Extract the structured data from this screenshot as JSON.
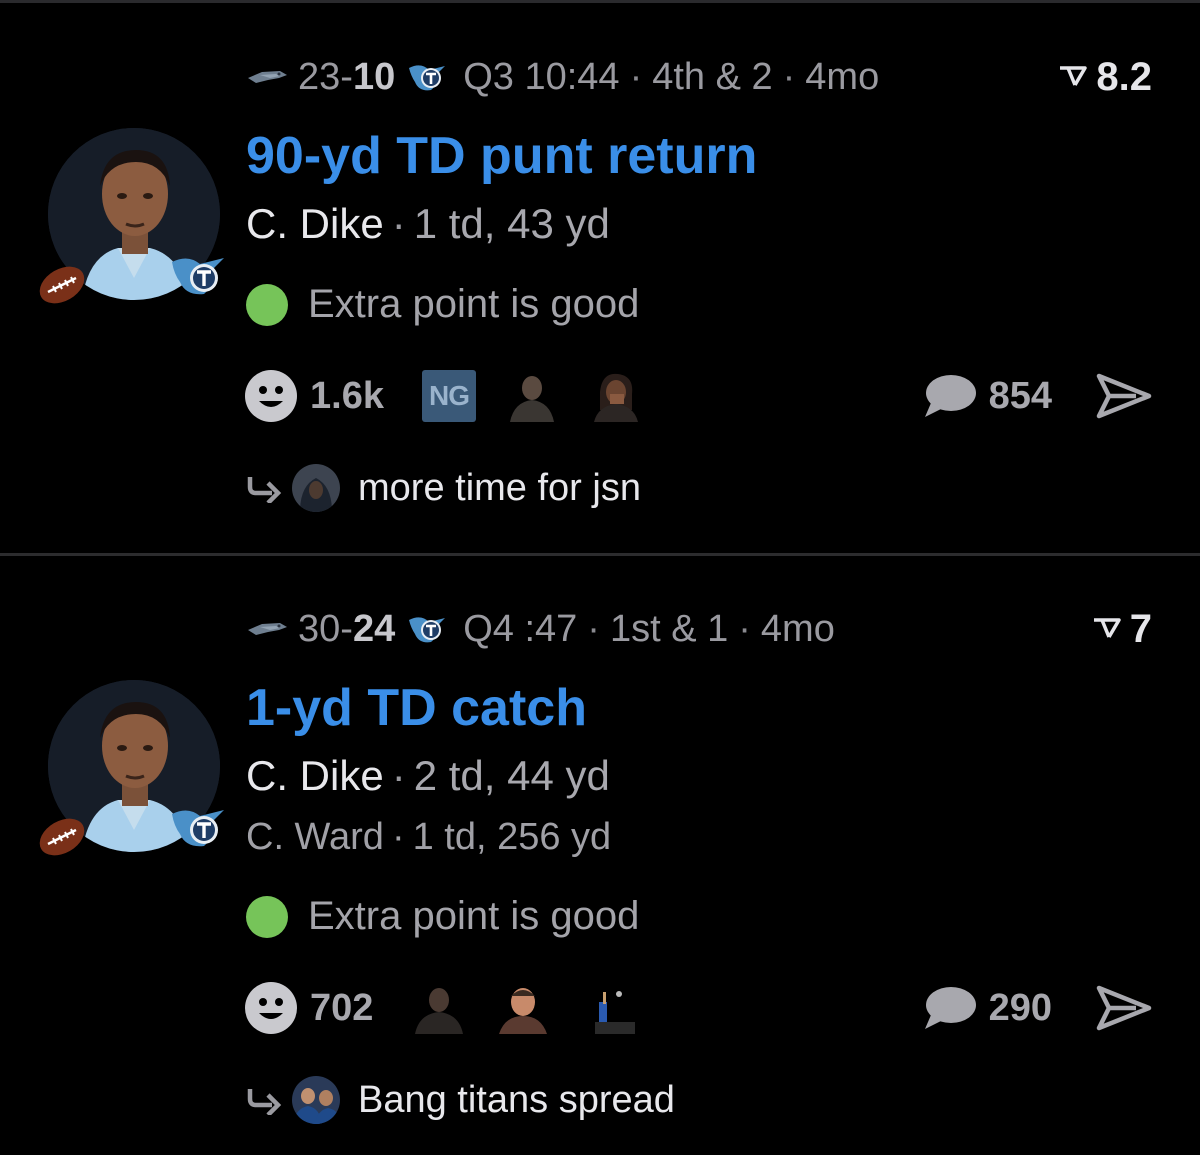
{
  "posts": [
    {
      "away_score": "23",
      "home_score": "10",
      "quarter": "Q3 10:44",
      "down": "4th & 2",
      "age": "4mo",
      "rating": "8.2",
      "title": "90-yd TD punt return",
      "player_name": "C. Dike",
      "player_stats": "1 td, 43 yd",
      "status": "Extra point is good",
      "reaction_count": "1.6k",
      "ng_badge": "NG",
      "comment_count": "854",
      "reply_text": "more time for jsn"
    },
    {
      "away_score": "30",
      "home_score": "24",
      "quarter": "Q4 :47",
      "down": "1st & 1",
      "age": "4mo",
      "rating": "7",
      "title": "1-yd TD catch",
      "player_name": "C. Dike",
      "player_stats": "2 td, 44 yd",
      "player2_name": "C. Ward",
      "player2_stats": "1 td, 256 yd",
      "status": "Extra point is good",
      "reaction_count": "702",
      "comment_count": "290",
      "reply_text": "Bang titans spread"
    }
  ],
  "separator": "·",
  "colors": {
    "title_blue": "#3a8ee8",
    "status_green": "#76c459",
    "background": "#000000",
    "muted_text": "#9a9aa0"
  },
  "icons": {
    "away_team": "seahawks-logo-icon",
    "home_team": "titans-logo-icon",
    "rating": "rating-flag-icon",
    "reaction": "smiley-icon",
    "comment": "speech-bubble-icon",
    "share": "send-arrow-icon",
    "reply": "reply-arrow-icon",
    "football": "football-icon"
  }
}
